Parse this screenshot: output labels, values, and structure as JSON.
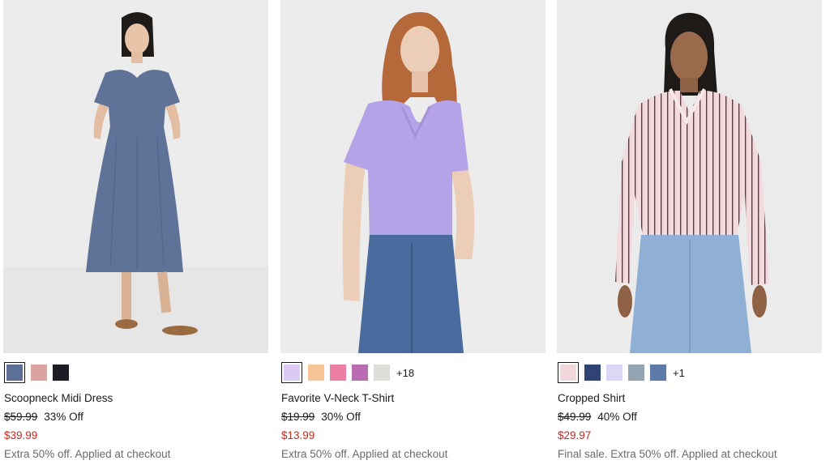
{
  "products": [
    {
      "image_alt": "Scoopneck Midi Dress",
      "name": "Scoopneck Midi Dress",
      "original_price": "$59.99",
      "discount": "33% Off",
      "sale_price": "$39.99",
      "promo": "Extra 50% off. Applied at checkout",
      "more_colors": "",
      "swatches": [
        "#5b6f97",
        "#d9a3a0",
        "#1c1d24"
      ],
      "selected_swatch": 0
    },
    {
      "image_alt": "Favorite V-Neck T-Shirt",
      "name": "Favorite V-Neck T-Shirt",
      "original_price": "$19.99",
      "discount": "30% Off",
      "sale_price": "$13.99",
      "promo": "Extra 50% off. Applied at checkout",
      "more_colors": "+18",
      "swatches": [
        "#d9c9f3",
        "#f5c394",
        "#ec7fa4",
        "#b86db3",
        "#deddd6"
      ],
      "selected_swatch": 0
    },
    {
      "image_alt": "Cropped Shirt",
      "name": "Cropped Shirt",
      "original_price": "$49.99",
      "discount": "40% Off",
      "sale_price": "$29.97",
      "promo": "Final sale. Extra 50% off. Applied at checkout",
      "more_colors": "+1",
      "swatches": [
        "#f2d8dc",
        "#2f4475",
        "#ddd6f4",
        "#93a5b3",
        "#5c79a8"
      ],
      "selected_swatch": 0
    }
  ]
}
